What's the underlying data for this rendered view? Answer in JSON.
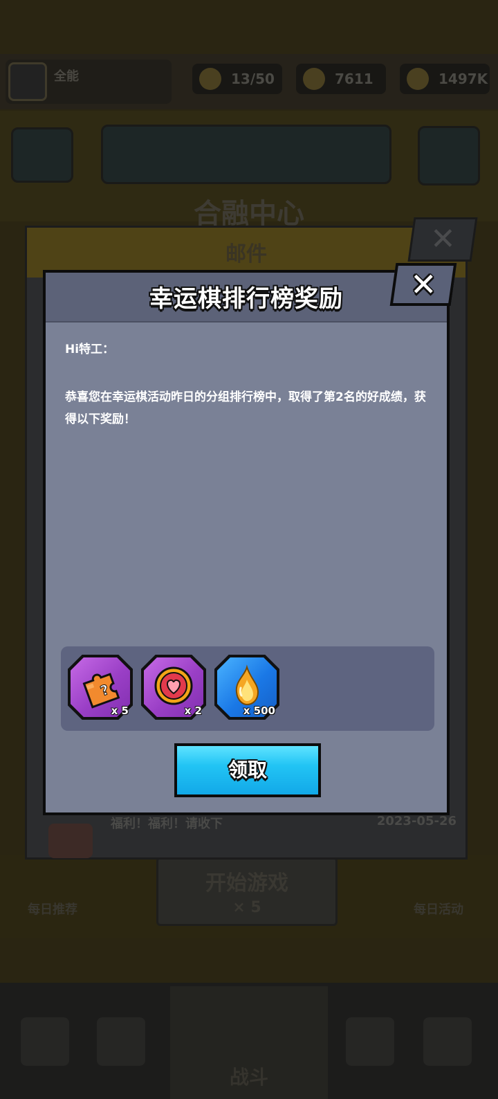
{
  "background": {
    "player_name": "全能",
    "stamina": "13/50",
    "gems": "7611",
    "coins": "1497K",
    "main_title": "合融中心",
    "start_button": "开始游戏",
    "start_cost": "× 5",
    "left_side_label": "每日推荐",
    "right_side_label": "每日活动",
    "battle_tab": "战斗"
  },
  "mail": {
    "header": "邮件",
    "row_title": "福利！福利！请收下",
    "row_date": "2023-05-26"
  },
  "dialog": {
    "title": "幸运棋排行榜奖励",
    "greeting": "Hi特工：",
    "body": "恭喜您在幸运棋活动昨日的分组排行榜中，取得了第2名的好成绩，获得以下奖励！",
    "claim_label": "领取",
    "rewards": [
      {
        "icon": "puzzle-piece-icon",
        "qty": "x 5",
        "frame": "purple"
      },
      {
        "icon": "heart-medal-icon",
        "qty": "x 2",
        "frame": "purple"
      },
      {
        "icon": "golden-flame-icon",
        "qty": "x 500",
        "frame": "blue"
      }
    ]
  },
  "colors": {
    "dialog_bg": "#7a8196",
    "dialog_header": "#5c6278",
    "claim_button": "#22c4f4",
    "reward_purple": "#9a3fc6",
    "reward_blue": "#1a78e6"
  }
}
